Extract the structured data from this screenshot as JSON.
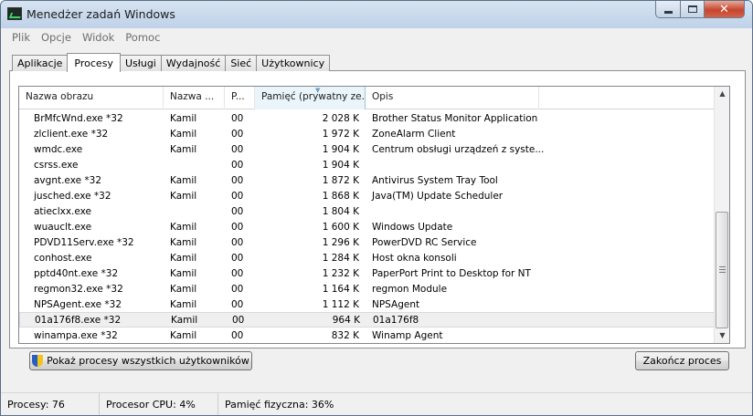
{
  "window": {
    "title": "Menedżer zadań Windows"
  },
  "menu": [
    "Plik",
    "Opcje",
    "Widok",
    "Pomoc"
  ],
  "tabs": [
    "Aplikacje",
    "Procesy",
    "Usługi",
    "Wydajność",
    "Sieć",
    "Użytkownicy"
  ],
  "active_tab": "Procesy",
  "columns": [
    "Nazwa obrazu",
    "Nazwa ...",
    "P...",
    "Pamięć (prywatny ze...",
    "Opis"
  ],
  "processes": [
    {
      "name": "BrMfcWnd.exe *32",
      "user": "Kamil",
      "prio": "00",
      "mem": "2 028 K",
      "desc": "Brother Status Monitor Application"
    },
    {
      "name": "zlclient.exe *32",
      "user": "Kamil",
      "prio": "00",
      "mem": "1 972 K",
      "desc": "ZoneAlarm Client"
    },
    {
      "name": "wmdc.exe",
      "user": "Kamil",
      "prio": "00",
      "mem": "1 904 K",
      "desc": "Centrum obsługi urządzeń z syste..."
    },
    {
      "name": "csrss.exe",
      "user": "",
      "prio": "00",
      "mem": "1 904 K",
      "desc": ""
    },
    {
      "name": "avgnt.exe *32",
      "user": "Kamil",
      "prio": "00",
      "mem": "1 872 K",
      "desc": "Antivirus System Tray Tool"
    },
    {
      "name": "jusched.exe *32",
      "user": "Kamil",
      "prio": "00",
      "mem": "1 868 K",
      "desc": "Java(TM) Update Scheduler"
    },
    {
      "name": "atieclxx.exe",
      "user": "",
      "prio": "00",
      "mem": "1 804 K",
      "desc": ""
    },
    {
      "name": "wuauclt.exe",
      "user": "Kamil",
      "prio": "00",
      "mem": "1 600 K",
      "desc": "Windows Update"
    },
    {
      "name": "PDVD11Serv.exe *32",
      "user": "Kamil",
      "prio": "00",
      "mem": "1 296 K",
      "desc": "PowerDVD RC Service"
    },
    {
      "name": "conhost.exe",
      "user": "Kamil",
      "prio": "00",
      "mem": "1 284 K",
      "desc": "Host okna konsoli"
    },
    {
      "name": "pptd40nt.exe *32",
      "user": "Kamil",
      "prio": "00",
      "mem": "1 232 K",
      "desc": "PaperPort Print to Desktop for NT"
    },
    {
      "name": "regmon32.exe *32",
      "user": "Kamil",
      "prio": "00",
      "mem": "1 164 K",
      "desc": "regmon Module"
    },
    {
      "name": "NPSAgent.exe *32",
      "user": "Kamil",
      "prio": "00",
      "mem": "1 112 K",
      "desc": "NPSAgent"
    },
    {
      "name": "01a176f8.exe *32",
      "user": "Kamil",
      "prio": "00",
      "mem": "964 K",
      "desc": "01a176f8"
    },
    {
      "name": "winampa.exe *32",
      "user": "Kamil",
      "prio": "00",
      "mem": "832 K",
      "desc": "Winamp Agent"
    }
  ],
  "selected_index": 13,
  "buttons": {
    "show_all": "Pokaż procesy wszystkich użytkowników",
    "end_process": "Zakończ proces"
  },
  "status": {
    "processes": "Procesy: 76",
    "cpu": "Procesor CPU: 4%",
    "memory": "Pamięć fizyczna: 36%"
  }
}
